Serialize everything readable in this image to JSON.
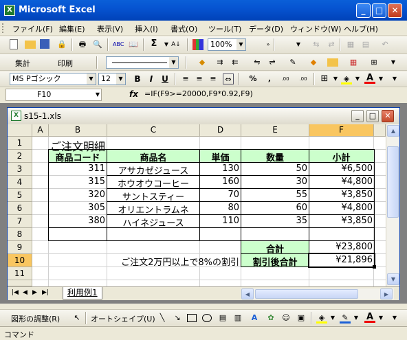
{
  "window": {
    "title": "Microsoft Excel",
    "app_icon": "X"
  },
  "menu": [
    "ファイル(F)",
    "編集(E)",
    "表示(V)",
    "挿入(I)",
    "書式(O)",
    "ツール(T)",
    "データ(D)",
    "ウィンドウ(W)",
    "ヘルプ(H)"
  ],
  "toolbar": {
    "zoom": "100%",
    "sum_label": "Σ",
    "shuukei": "集計",
    "insatsu": "印刷",
    "font_name": "MS Pゴシック",
    "font_size": "12",
    "bold": "B",
    "italic": "I",
    "underline": "U",
    "percent": "%",
    "comma": ",",
    "inc_decimal": ".00 →.0",
    "dec_decimal": ".00 ←.0"
  },
  "formula_bar": {
    "name_box": "F10",
    "fx": "fx",
    "formula": "=IF(F9>=20000,F9*0.92,F9)"
  },
  "workbook": {
    "title": "s15-1.xls",
    "sheet_tab": "利用例1"
  },
  "columns": [
    "A",
    "B",
    "C",
    "D",
    "E",
    "F"
  ],
  "rows": [
    "1",
    "2",
    "3",
    "4",
    "5",
    "6",
    "7",
    "8",
    "9",
    "10",
    "11"
  ],
  "sheet": {
    "title": "ご注文明細",
    "headers": [
      "商品コード",
      "商品名",
      "単価",
      "数量",
      "小計"
    ],
    "items": [
      {
        "code": "311",
        "name": "アサカゼジュース",
        "price": "130",
        "qty": "50",
        "subtotal": "¥6,500"
      },
      {
        "code": "315",
        "name": "ホウオウコーヒー",
        "price": "160",
        "qty": "30",
        "subtotal": "¥4,800"
      },
      {
        "code": "320",
        "name": "サントスティー",
        "price": "70",
        "qty": "55",
        "subtotal": "¥3,850"
      },
      {
        "code": "305",
        "name": "オリエントラムネ",
        "price": "80",
        "qty": "60",
        "subtotal": "¥4,800"
      },
      {
        "code": "380",
        "name": "ハイネジュース",
        "price": "110",
        "qty": "35",
        "subtotal": "¥3,850"
      }
    ],
    "total_label": "合計",
    "total_value": "¥23,800",
    "discount_note": "ご注文2万円以上で8%の割引",
    "discount_label": "割引後合計",
    "discount_value": "¥21,896"
  },
  "drawing_toolbar": {
    "shape_adjust": "図形の調整(R)",
    "autoshape": "オートシェイプ(U)"
  },
  "status": "コマンド",
  "colors": {
    "header_fill": "#ccffcc",
    "selected_header": "#f9c660",
    "title_bar": "#0654d1"
  }
}
